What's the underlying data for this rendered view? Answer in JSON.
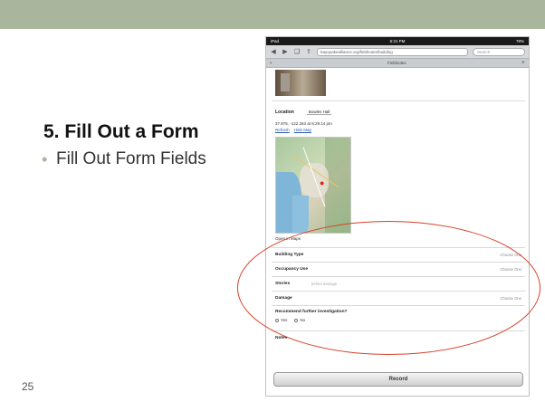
{
  "slide": {
    "title": "5. Fill Out a Form",
    "bullet": "Fill Out Form Fields",
    "page_number": "25",
    "accent_color": "#a9b59c"
  },
  "tablet": {
    "status": {
      "carrier": "iPad",
      "time": "6:31 PM",
      "battery": "78%"
    },
    "url": "bayquakealliance.org/fieldnotes/building",
    "search_placeholder": "Search",
    "tab_title": "Fieldnotes",
    "location": {
      "label": "Location",
      "value": "Bowles Hall",
      "coords": "37.875, -122.263 at 8:29:14 pm",
      "links": [
        "Refresh",
        "Hide Map"
      ],
      "open_in_maps": "Open in Maps"
    },
    "fields": [
      {
        "label": "Building Type",
        "value": "Choose One"
      },
      {
        "label": "Occupancy Use",
        "value": "Choose One"
      },
      {
        "label": "Stories",
        "placeholder": "before damage"
      },
      {
        "label": "Damage",
        "value": "Choose One"
      }
    ],
    "recommend": {
      "label": "Recommend further investigation?",
      "options": [
        "Yes",
        "No"
      ]
    },
    "notes_label": "Notes",
    "record_button": "Record"
  },
  "annotation_color": "#d4432a"
}
